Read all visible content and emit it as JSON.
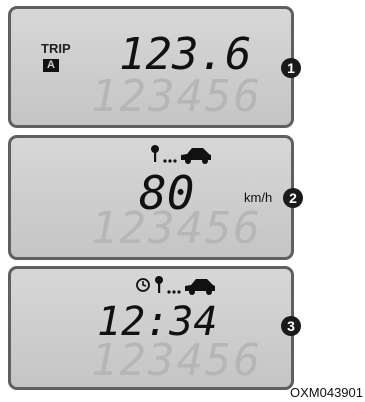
{
  "panel1": {
    "trip_label": "TRIP",
    "trip_badge": "A",
    "value": "123.6",
    "callout": "1"
  },
  "panel2": {
    "value": "80",
    "unit": "km/h",
    "callout": "2"
  },
  "panel3": {
    "value": "12:34",
    "callout": "3"
  },
  "ghost_digits": "123456",
  "figure_code": "OXM043901",
  "icons": [
    "key-icon",
    "car-icon",
    "clock-icon"
  ],
  "colors": {
    "lcd_background": "#cbcbcb",
    "lcd_text": "#111111",
    "panel_border": "#5f5f5f"
  }
}
